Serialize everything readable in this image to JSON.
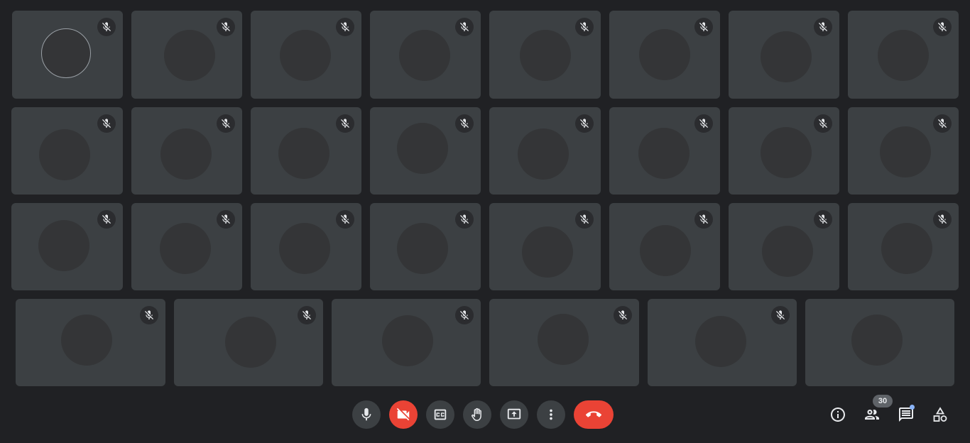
{
  "meeting": {
    "participant_count": "30"
  },
  "tiles": {
    "row1": [
      {
        "muted": true,
        "avatar": "avatar-circle"
      },
      {
        "muted": true,
        "avatar": "avatar-circle"
      },
      {
        "muted": true,
        "avatar": "avatar-circle"
      },
      {
        "muted": true,
        "avatar": "avatar-circle"
      },
      {
        "muted": true,
        "avatar": "avatar-circle"
      },
      {
        "muted": true,
        "avatar": "avatar-circle"
      },
      {
        "muted": true,
        "avatar": "avatar-circle"
      },
      {
        "muted": true,
        "avatar": "avatar-circle"
      }
    ],
    "row2": [
      {
        "muted": true
      },
      {
        "muted": true
      },
      {
        "muted": true
      },
      {
        "muted": true
      },
      {
        "muted": true
      },
      {
        "muted": true
      },
      {
        "muted": true
      },
      {
        "muted": true
      }
    ],
    "row3": [
      {
        "muted": true
      },
      {
        "muted": true
      },
      {
        "muted": true
      },
      {
        "muted": true
      },
      {
        "muted": true
      },
      {
        "muted": true
      },
      {
        "muted": true
      },
      {
        "muted": true
      }
    ],
    "row4": [
      {
        "muted": true
      },
      {
        "muted": true
      },
      {
        "muted": true
      },
      {
        "muted": true
      },
      {
        "muted": true
      },
      {
        "muted": false
      }
    ]
  },
  "controls": {
    "microphone": {
      "icon": "microphone-icon"
    },
    "camera": {
      "icon": "camera-off-icon",
      "state": "off"
    },
    "captions": {
      "icon": "captions-icon"
    },
    "raise_hand": {
      "icon": "raise-hand-icon"
    },
    "present": {
      "icon": "present-screen-icon"
    },
    "more": {
      "icon": "more-options-icon"
    },
    "leave": {
      "icon": "hang-up-icon"
    }
  },
  "side_panel": {
    "info": {
      "icon": "info-icon"
    },
    "people": {
      "icon": "people-icon"
    },
    "chat": {
      "icon": "chat-icon",
      "unread": true
    },
    "activities": {
      "icon": "activities-icon"
    }
  },
  "colors": {
    "background": "#202124",
    "tile": "#3c4043",
    "avatar": "#343537",
    "danger": "#ea4335",
    "accent": "#8ab4f8"
  }
}
